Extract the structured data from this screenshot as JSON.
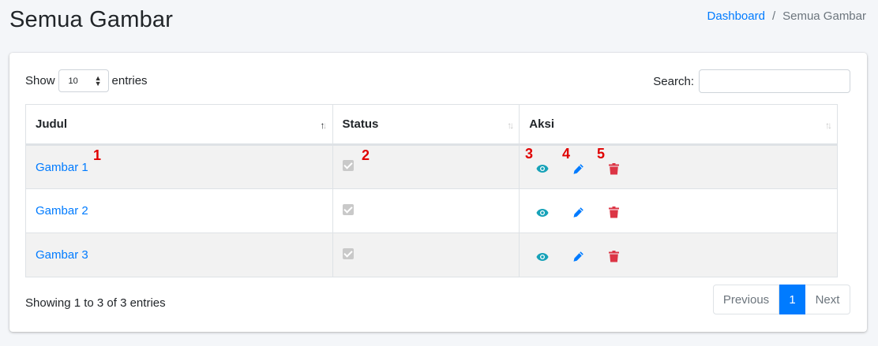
{
  "header": {
    "title": "Semua Gambar",
    "breadcrumb": {
      "link": "Dashboard",
      "separator": "/",
      "current": "Semua Gambar"
    }
  },
  "controls": {
    "show_label": "Show",
    "entries_value": "10",
    "entries_label": "entries",
    "search_label": "Search:",
    "search_value": ""
  },
  "table": {
    "columns": [
      "Judul",
      "Status",
      "Aksi"
    ],
    "rows": [
      {
        "title": "Gambar 1",
        "status_checked": true
      },
      {
        "title": "Gambar 2",
        "status_checked": true
      },
      {
        "title": "Gambar 3",
        "status_checked": true
      }
    ]
  },
  "annotations": [
    "1",
    "2",
    "3",
    "4",
    "5"
  ],
  "footer": {
    "info": "Showing 1 to 3 of 3 entries",
    "previous": "Previous",
    "page": "1",
    "next": "Next"
  },
  "colors": {
    "link": "#007bff",
    "view": "#17a2b8",
    "edit": "#007bff",
    "delete": "#dc3545",
    "annotation": "#e00000"
  },
  "icons": {
    "view": "eye-icon",
    "edit": "pencil-icon",
    "delete": "trash-icon"
  }
}
